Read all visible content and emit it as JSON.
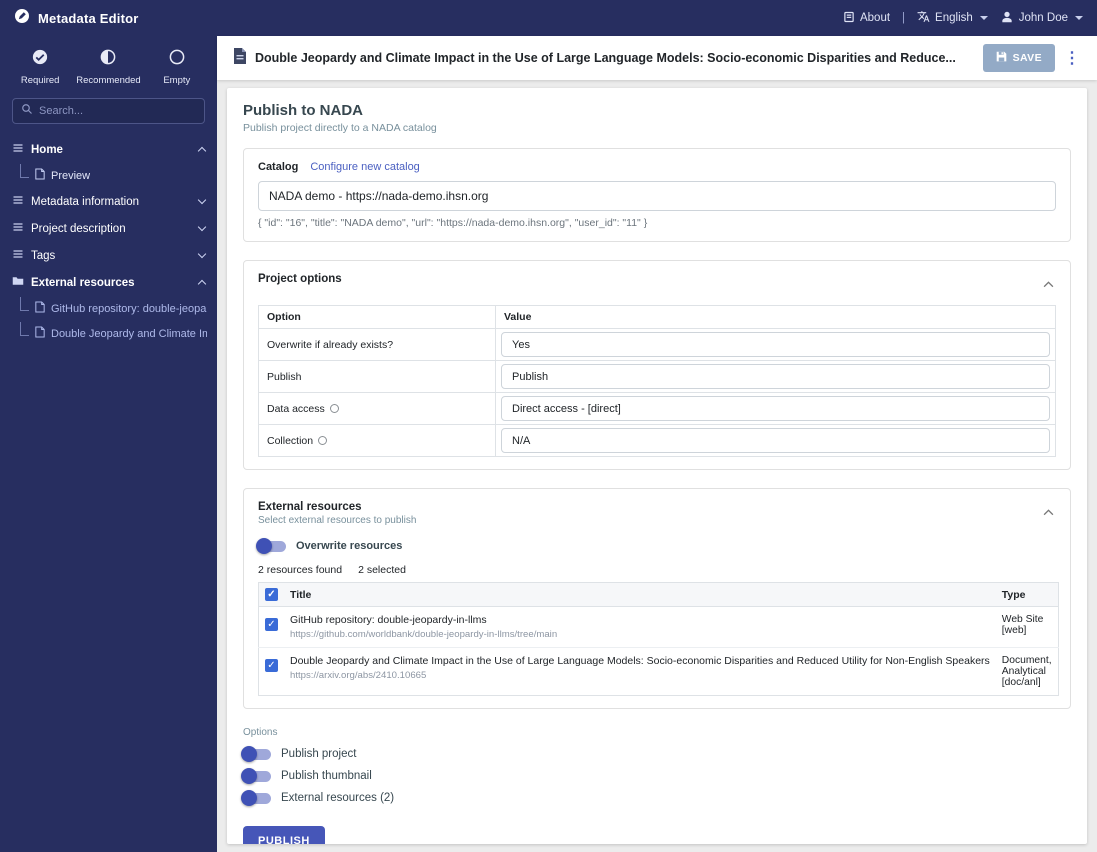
{
  "topbar": {
    "app_title": "Metadata Editor",
    "about": "About",
    "separator": "|",
    "language": "English",
    "user": "John Doe"
  },
  "icons": {
    "kebab": "⋮"
  },
  "sidebar": {
    "legend": [
      {
        "label": "Required"
      },
      {
        "label": "Recommended"
      },
      {
        "label": "Empty"
      }
    ],
    "search_placeholder": "Search...",
    "nav": [
      {
        "label": "Home",
        "children": [
          {
            "label": "Preview"
          }
        ]
      },
      {
        "label": "Metadata information"
      },
      {
        "label": "Project description"
      },
      {
        "label": "Tags"
      },
      {
        "label": "External resources",
        "children": [
          {
            "label": "GitHub repository: double-jeopardy-i"
          },
          {
            "label": "Double Jeopardy and Climate Impac"
          }
        ]
      }
    ]
  },
  "header": {
    "title": "Double Jeopardy and Climate Impact in the Use of Large Language Models: Socio-economic Disparities and Reduce...",
    "save_label": "SAVE"
  },
  "page": {
    "title": "Publish to NADA",
    "subtitle": "Publish project directly to a NADA catalog",
    "catalog": {
      "label": "Catalog",
      "configure_link": "Configure new catalog",
      "selected": "NADA demo - https://nada-demo.ihsn.org",
      "helper": "{ \"id\": \"16\", \"title\": \"NADA demo\", \"url\": \"https://nada-demo.ihsn.org\", \"user_id\": \"11\" }"
    },
    "project_options": {
      "title": "Project options",
      "columns": [
        "Option",
        "Value"
      ],
      "rows": [
        {
          "option": "Overwrite if already exists?",
          "value": "Yes"
        },
        {
          "option": "Publish",
          "value": "Publish"
        },
        {
          "option": "Data access",
          "value": "Direct access - [direct]"
        },
        {
          "option": "Collection",
          "value": "N/A"
        }
      ]
    },
    "external_resources": {
      "title": "External resources",
      "subtitle": "Select external resources to publish",
      "overwrite_label": "Overwrite resources",
      "found_text": "2 resources found",
      "selected_text": "2 selected",
      "columns": [
        "Title",
        "Type"
      ],
      "rows": [
        {
          "title": "GitHub repository: double-jeopardy-in-llms",
          "url": "https://github.com/worldbank/double-jeopardy-in-llms/tree/main",
          "type": "Web Site [web]"
        },
        {
          "title": "Double Jeopardy and Climate Impact in the Use of Large Language Models: Socio-economic Disparities and Reduced Utility for Non-English Speakers",
          "url": "https://arxiv.org/abs/2410.10665",
          "type": "Document, Analytical [doc/anl]"
        }
      ]
    },
    "options": {
      "label": "Options",
      "toggles": [
        {
          "label": "Publish project"
        },
        {
          "label": "Publish thumbnail"
        },
        {
          "label": "External resources (2)"
        }
      ]
    },
    "publish_label": "PUBLISH"
  },
  "colors": {
    "navy": "#272e60",
    "accent": "#4656b8",
    "link": "#4a5fc1",
    "save_button": "#93aac6",
    "toggle_thumb": "#3f51b5",
    "toggle_track": "#9fa8da",
    "checkbox": "#3a6bd7"
  }
}
